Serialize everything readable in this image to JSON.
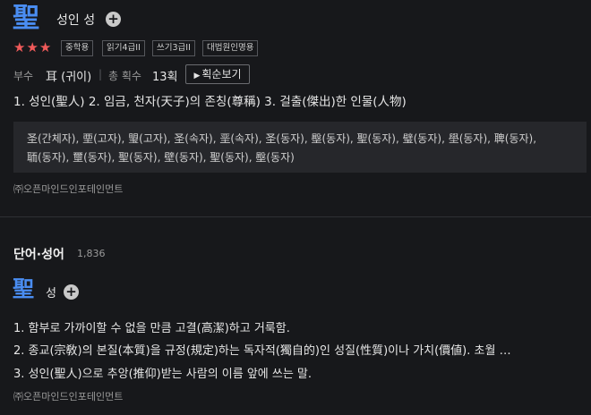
{
  "entry": {
    "hanja": "聖",
    "reading": "성인 성",
    "plus_label": "+",
    "stars": "★★★",
    "badges": [
      "중학용",
      "읽기4급II",
      "쓰기3급II",
      "대법원인명용"
    ],
    "radical_label": "부수",
    "radical_value": "耳 (귀이)",
    "sep": "|",
    "stroke_label": "총 획수",
    "stroke_value": "13획",
    "stroke_button": "획순보기",
    "definition": "1. 성인(聖人)  2. 임금, 천자(天子)의 존칭(尊稱)  3. 걸출(傑出)한 인물(人物)",
    "variants_line1": "圣(간체자), 垔(고자), 琞(고자), 圣(속자), 垩(속자), 圣(동자), 壂(동자), 聖(동자), 璧(동자), 壆(동자), 聛(동자),",
    "variants_line2": "聏(동자), 壐(동자), 聖(동자), 壁(동자), 聖(동자), 壂(동자)",
    "copyright": "㈜오픈마인드인포테인먼트"
  },
  "words": {
    "title": "단어·성어",
    "count": "1,836",
    "hanja": "聖",
    "reading": "성",
    "plus_label": "+",
    "meanings": [
      "1. 함부로 가까이할 수 없을 만큼 고결(高潔)하고 거룩함.",
      "2. 종교(宗敎)의 본질(本質)을 규정(規定)하는 독자적(獨自的)인 성질(性質)이나 가치(價値). 초월 …",
      "3. 성인(聖人)으로 추앙(推仰)받는 사람의 이름 앞에 쓰는 말."
    ],
    "copyright": "㈜오픈마인드인포테인먼트"
  }
}
